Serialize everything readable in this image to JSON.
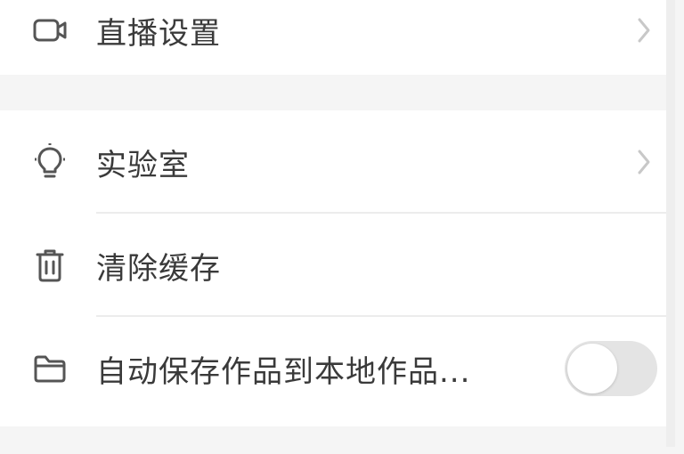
{
  "settings": {
    "live": {
      "label": "直播设置",
      "icon": "video-camera-icon"
    },
    "lab": {
      "label": "实验室",
      "icon": "lightbulb-icon"
    },
    "cache": {
      "label": "清除缓存",
      "icon": "trash-icon"
    },
    "autosave": {
      "label": "自动保存作品到本地作品...",
      "icon": "folder-icon",
      "toggle_on": false
    }
  },
  "colors": {
    "background": "#f5f5f5",
    "card": "#ffffff",
    "text": "#3a3a3a",
    "icon": "#555555",
    "chevron": "#c8c8c8",
    "toggle_off": "#e4e4e4"
  }
}
